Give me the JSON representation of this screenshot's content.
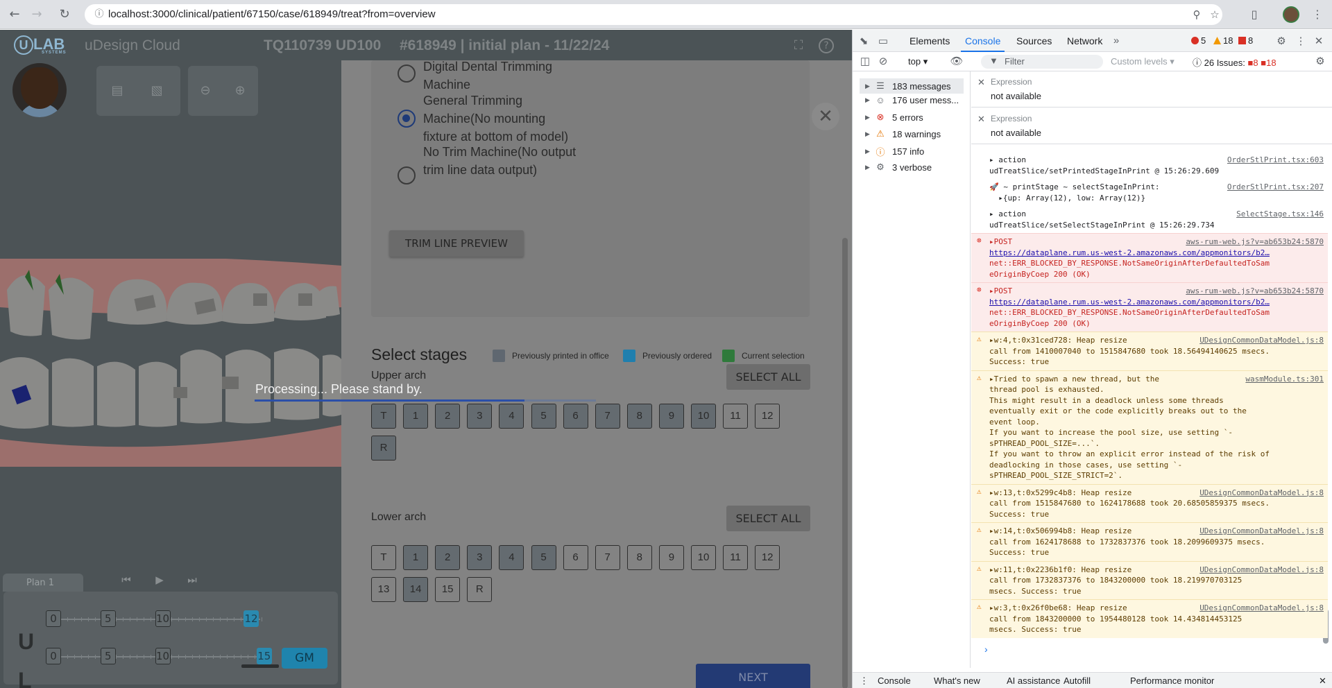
{
  "browser": {
    "url": "localhost:3000/clinical/patient/67150/case/618949/treat?from=overview"
  },
  "app": {
    "logo_text": "U",
    "logo_sub": "LAB",
    "logo_tag": "SYSTEMS",
    "product": "uDesign Cloud",
    "case_code": "TQ110739 UD100",
    "case_info": "#618949 | initial plan - 11/22/24"
  },
  "plan": {
    "tab_label": "Plan 1",
    "upper_label": "U",
    "lower_label": "L",
    "upper_steps": [
      "0",
      "5",
      "10",
      "12"
    ],
    "lower_steps": [
      "0",
      "5",
      "10",
      "15"
    ],
    "gm_label": "GM"
  },
  "trim": {
    "options": [
      {
        "label_lines": [
          "Digital Dental Trimming",
          "Machine"
        ],
        "selected": false
      },
      {
        "label_lines": [
          "General Trimming",
          "Machine(No mounting",
          "fixture at bottom of model)"
        ],
        "selected": true
      },
      {
        "label_lines": [
          "No Trim Machine(No output",
          "trim line data output)"
        ],
        "selected": false
      }
    ],
    "preview_button": "TRIM LINE PREVIEW"
  },
  "stages": {
    "title": "Select stages",
    "legend": [
      {
        "label": "Previously printed in office",
        "color": "#5f6770"
      },
      {
        "label": "Previously ordered",
        "color": "#1f7fae"
      },
      {
        "label": "Current selection",
        "color": "#2f7a3b"
      }
    ],
    "upper": {
      "label": "Upper arch",
      "select_all": "SELECT ALL",
      "items": [
        {
          "t": "T",
          "dark": true
        },
        {
          "t": "1",
          "dark": true
        },
        {
          "t": "2",
          "dark": true
        },
        {
          "t": "3",
          "dark": true
        },
        {
          "t": "4",
          "dark": true
        },
        {
          "t": "5",
          "dark": true
        },
        {
          "t": "6",
          "dark": true
        },
        {
          "t": "7",
          "dark": true
        },
        {
          "t": "8",
          "dark": true
        },
        {
          "t": "9",
          "dark": true
        },
        {
          "t": "10",
          "dark": true
        },
        {
          "t": "11",
          "dark": false
        },
        {
          "t": "12",
          "dark": false
        },
        {
          "t": "R",
          "dark": true
        }
      ]
    },
    "lower": {
      "label": "Lower arch",
      "select_all": "SELECT ALL",
      "items": [
        {
          "t": "T",
          "dark": false
        },
        {
          "t": "1",
          "dark": true
        },
        {
          "t": "2",
          "dark": true
        },
        {
          "t": "3",
          "dark": true
        },
        {
          "t": "4",
          "dark": true
        },
        {
          "t": "5",
          "dark": true
        },
        {
          "t": "6",
          "dark": false
        },
        {
          "t": "7",
          "dark": false
        },
        {
          "t": "8",
          "dark": false
        },
        {
          "t": "9",
          "dark": false
        },
        {
          "t": "10",
          "dark": false
        },
        {
          "t": "11",
          "dark": false
        },
        {
          "t": "12",
          "dark": false
        },
        {
          "t": "13",
          "dark": false
        },
        {
          "t": "14",
          "dark": true
        },
        {
          "t": "15",
          "dark": false
        },
        {
          "t": "R",
          "dark": false
        }
      ]
    },
    "next": "NEXT"
  },
  "overlay": {
    "processing_text": "Processing... Please stand by.",
    "progress": 0.79
  },
  "devtools": {
    "tabs": [
      "Elements",
      "Console",
      "Sources",
      "Network"
    ],
    "active_tab": "Console",
    "err_count": "5",
    "warn_count": "18",
    "issue_count": "8",
    "context": "top",
    "filter_placeholder": "Filter",
    "levels": "Custom levels",
    "issues_label": "26 Issues:",
    "issues_err": "8",
    "issues_info": "18",
    "sidebar": [
      {
        "label": "183 messages",
        "icon": "list",
        "color": "#5f6368"
      },
      {
        "label": "176 user mess...",
        "icon": "user",
        "color": "#5f6368"
      },
      {
        "label": "5 errors",
        "icon": "error",
        "color": "#d93025"
      },
      {
        "label": "18 warnings",
        "icon": "warning",
        "color": "#e37400"
      },
      {
        "label": "157 info",
        "icon": "info",
        "color": "#e37400"
      },
      {
        "label": "3 verbose",
        "icon": "bug",
        "color": "#5f6368"
      }
    ],
    "expressions": [
      {
        "label": "Expression",
        "value": "not available"
      },
      {
        "label": "Expression",
        "value": "not available"
      }
    ],
    "logs": [
      {
        "kind": "info",
        "lines": [
          "▸ action",
          "udTreatSlice/setPrintedStageInPrint @ 15:26:29.609"
        ],
        "link": "OrderStlPrint.tsx:603"
      },
      {
        "kind": "info",
        "lines": [
          "🚀 ~ printStage ~ selectStageInPrint:",
          "  ▸{up: Array(12), low: Array(12)}"
        ],
        "link": "OrderStlPrint.tsx:207"
      },
      {
        "kind": "info",
        "lines": [
          "▸ action",
          "udTreatSlice/setSelectStageInPrint @ 15:26:29.734"
        ],
        "link": "SelectStage.tsx:146"
      },
      {
        "kind": "err",
        "lines": [
          "▸POST",
          "https://dataplane.rum.us-west-2.amazonaws.com/appmonitors/b2…",
          "net::ERR_BLOCKED_BY_RESPONSE.NotSameOriginAfterDefaultedToSam",
          "eOriginByCoep 200 (OK)"
        ],
        "link": "aws-rum-web.js?v=ab653b24:5870"
      },
      {
        "kind": "err",
        "lines": [
          "▸POST",
          "https://dataplane.rum.us-west-2.amazonaws.com/appmonitors/b2…",
          "net::ERR_BLOCKED_BY_RESPONSE.NotSameOriginAfterDefaultedToSam",
          "eOriginByCoep 200 (OK)"
        ],
        "link": "aws-rum-web.js?v=ab653b24:5870"
      },
      {
        "kind": "warn",
        "lines": [
          "▸w:4,t:0x31ced728: Heap resize",
          "call from 1410007040 to 1515847680 took 18.56494140625 msecs.",
          "Success: true"
        ],
        "link": "UDesignCommonDataModel.js:8"
      },
      {
        "kind": "warn",
        "lines": [
          "▸Tried to spawn a new thread, but the",
          "thread pool is exhausted.",
          "This might result in a deadlock unless some threads",
          "eventually exit or the code explicitly breaks out to the",
          "event loop.",
          "If you want to increase the pool size, use setting `-",
          "sPTHREAD_POOL_SIZE=...`.",
          "If you want to throw an explicit error instead of the risk of",
          "deadlocking in those cases, use setting `-",
          "sPTHREAD_POOL_SIZE_STRICT=2`."
        ],
        "link": "wasmModule.ts:301"
      },
      {
        "kind": "warn",
        "lines": [
          "▸w:13,t:0x5299c4b8: Heap resize",
          "call from 1515847680 to 1624178688 took 20.68505859375 msecs.",
          "Success: true"
        ],
        "link": "UDesignCommonDataModel.js:8"
      },
      {
        "kind": "warn",
        "lines": [
          "▸w:14,t:0x506994b8: Heap resize",
          "call from 1624178688 to 1732837376 took 18.2099609375 msecs.",
          "Success: true"
        ],
        "link": "UDesignCommonDataModel.js:8"
      },
      {
        "kind": "warn",
        "lines": [
          "▸w:11,t:0x2236b1f0: Heap resize",
          "call from 1732837376 to 1843200000 took 18.219970703125",
          "msecs. Success: true"
        ],
        "link": "UDesignCommonDataModel.js:8"
      },
      {
        "kind": "warn",
        "lines": [
          "▸w:3,t:0x26f0be68: Heap resize",
          "call from 1843200000 to 1954480128 took 14.434814453125",
          "msecs. Success: true"
        ],
        "link": "UDesignCommonDataModel.js:8"
      }
    ],
    "drawer": [
      "Console",
      "What's new",
      "AI assistance",
      "Autofill",
      "Performance monitor"
    ]
  }
}
